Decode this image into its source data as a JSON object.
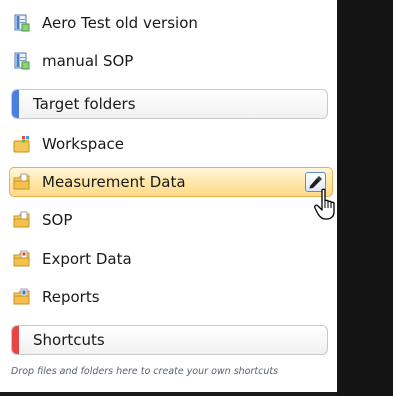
{
  "documents": [
    {
      "label": "Aero Test old version",
      "icon": "document-icon"
    },
    {
      "label": "manual SOP",
      "icon": "document-icon"
    }
  ],
  "target_folders": {
    "header": "Target folders",
    "accent_color": "#4a7fe0",
    "items": [
      {
        "label": "Workspace",
        "icon": "workspace-folder-icon"
      },
      {
        "label": "Measurement Data",
        "icon": "folder-icon",
        "selected": true
      },
      {
        "label": "SOP",
        "icon": "folder-icon"
      },
      {
        "label": "Export Data",
        "icon": "folder-icon"
      },
      {
        "label": "Reports",
        "icon": "folder-icon"
      }
    ]
  },
  "shortcuts": {
    "header": "Shortcuts",
    "accent_color": "#e84545",
    "hint": "Drop files and folders here to create your own shortcuts"
  },
  "selection": {
    "edit_button_icon": "edit-pen-icon",
    "cursor": "hand-cursor-icon"
  },
  "colors": {
    "selection_border": "#e8b24a",
    "selection_fill": "#ffe6a6",
    "side_pane": "#141414"
  }
}
